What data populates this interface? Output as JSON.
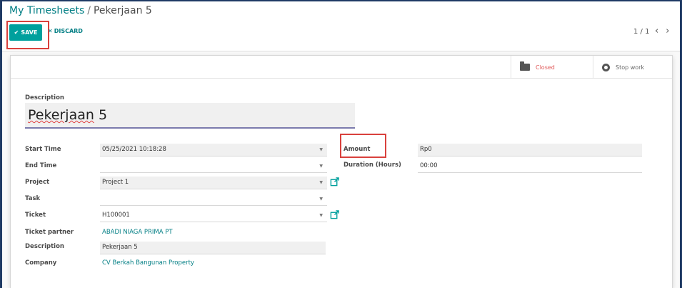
{
  "breadcrumb": {
    "parent": "My Timesheets",
    "separator": "/",
    "current": "Pekerjaan 5"
  },
  "toolbar": {
    "save_label": "SAVE",
    "discard_label": "DISCARD",
    "pager": "1 / 1"
  },
  "stat_buttons": {
    "closed": "Closed",
    "stop_work": "Stop work"
  },
  "form": {
    "description_label": "Description",
    "description_title": "Pekerjaan 5",
    "description_title_spell": "Pekerjaan",
    "description_title_rest": " 5",
    "start_time_label": "Start Time",
    "start_time_value": "05/25/2021 10:18:28",
    "end_time_label": "End Time",
    "end_time_value": "",
    "project_label": "Project",
    "project_value": "Project 1",
    "task_label": "Task",
    "task_value": "",
    "ticket_label": "Ticket",
    "ticket_value": "H100001",
    "ticket_partner_label": "Ticket partner",
    "ticket_partner_value": "ABADI NIAGA PRIMA PT",
    "description2_label": "Description",
    "description2_value": "Pekerjaan 5",
    "company_label": "Company",
    "company_value": "CV Berkah Bangunan Property",
    "amount_label": "Amount",
    "amount_value": "Rp0",
    "duration_label": "Duration (Hours)",
    "duration_value": "00:00"
  },
  "colors": {
    "primary": "#00a09d",
    "link": "#017e84",
    "highlight": "#d9413d",
    "closed_status": "#e05a5a"
  }
}
